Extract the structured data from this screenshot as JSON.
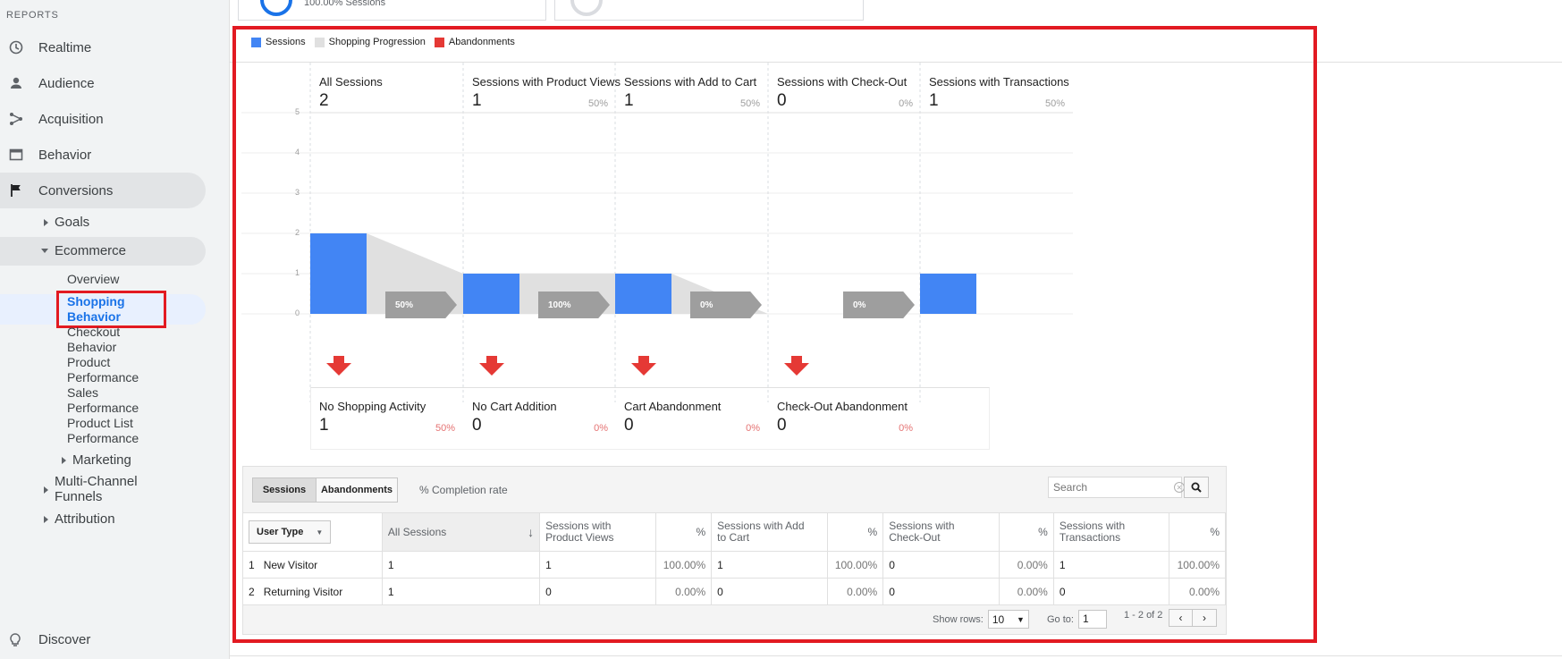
{
  "sidebar": {
    "section_label": "REPORTS",
    "items": [
      {
        "label": "Realtime",
        "icon": "clock-icon"
      },
      {
        "label": "Audience",
        "icon": "person-icon"
      },
      {
        "label": "Acquisition",
        "icon": "acquisition-icon"
      },
      {
        "label": "Behavior",
        "icon": "behavior-icon"
      },
      {
        "label": "Conversions",
        "icon": "flag-icon"
      }
    ],
    "conversions_children": {
      "goals": "Goals",
      "ecommerce": "Ecommerce",
      "ecommerce_children": {
        "overview": "Overview",
        "shopping_behavior_1": "Shopping",
        "shopping_behavior_2": "Behavior",
        "checkout_1": "Checkout",
        "checkout_2": "Behavior",
        "product_1": "Product",
        "product_2": "Performance",
        "sales_1": "Sales",
        "sales_2": "Performance",
        "product_list_1": "Product List",
        "product_list_2": "Performance"
      },
      "marketing": "Marketing",
      "multi_channel_1": "Multi-Channel",
      "multi_channel_2": "Funnels",
      "attribution": "Attribution"
    },
    "discover": "Discover"
  },
  "top_card": {
    "text": "100.00% Sessions"
  },
  "legend": {
    "sessions": "Sessions",
    "progression": "Shopping Progression",
    "abandonments": "Abandonments",
    "colors": {
      "sessions": "#4285f4",
      "progression": "#e0e0e0",
      "abandonments": "#e53935"
    }
  },
  "chart_data": {
    "type": "bar",
    "y_ticks": [
      "5",
      "4",
      "3",
      "2",
      "1",
      "0"
    ],
    "ylim": [
      0,
      5
    ],
    "categories": [
      "All Sessions",
      "Sessions with Product Views",
      "Sessions with Add to Cart",
      "Sessions with Check-Out",
      "Sessions with Transactions"
    ],
    "values": [
      2,
      1,
      1,
      0,
      1
    ],
    "value_labels": [
      "2",
      "1",
      "1",
      "0",
      "1"
    ],
    "stage_pcts": [
      "",
      "50%",
      "50%",
      "0%",
      "50%"
    ],
    "progression_labels": [
      "50%",
      "100%",
      "0%",
      "0%"
    ],
    "abandonments": [
      {
        "label": "No Shopping Activity",
        "value": "1",
        "pct": "50%"
      },
      {
        "label": "No Cart Addition",
        "value": "0",
        "pct": "0%"
      },
      {
        "label": "Cart Abandonment",
        "value": "0",
        "pct": "0%"
      },
      {
        "label": "Check-Out Abandonment",
        "value": "0",
        "pct": "0%"
      }
    ]
  },
  "table": {
    "tab_sessions": "Sessions",
    "tab_abandonments": "Abandonments",
    "completion_rate": "% Completion rate",
    "search_placeholder": "Search",
    "dimension": "User Type",
    "headers": {
      "all_sessions": "All Sessions",
      "product_views_1": "Sessions with",
      "product_views_2": "Product Views",
      "pct": "%",
      "add_to_cart_1": "Sessions with Add",
      "add_to_cart_2": "to Cart",
      "checkout_1": "Sessions with",
      "checkout_2": "Check-Out",
      "transactions_1": "Sessions with",
      "transactions_2": "Transactions"
    },
    "rows": [
      {
        "idx": "1",
        "type": "New Visitor",
        "all": "1",
        "pv": "1",
        "pv_pct": "100.00%",
        "atc": "1",
        "atc_pct": "100.00%",
        "co": "0",
        "co_pct": "0.00%",
        "tr": "1",
        "tr_pct": "100.00%"
      },
      {
        "idx": "2",
        "type": "Returning Visitor",
        "all": "1",
        "pv": "0",
        "pv_pct": "0.00%",
        "atc": "0",
        "atc_pct": "0.00%",
        "co": "0",
        "co_pct": "0.00%",
        "tr": "0",
        "tr_pct": "0.00%"
      }
    ],
    "show_rows_label": "Show rows:",
    "show_rows_value": "10",
    "goto_label": "Go to:",
    "goto_value": "1",
    "range": "1 - 2 of 2"
  }
}
